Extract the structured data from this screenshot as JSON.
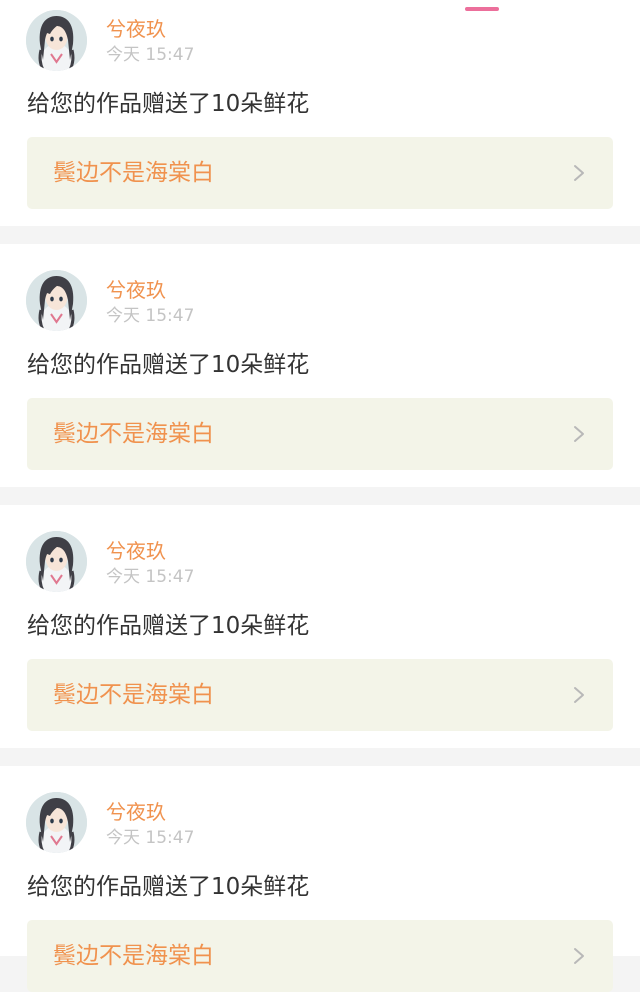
{
  "colors": {
    "accent": "#f0924e",
    "tab_indicator": "#ec6f9b",
    "work_box_bg": "#f3f4e8",
    "page_bg": "#f4f4f4",
    "time_text": "#c4c4c4",
    "message_text": "#333333"
  },
  "notifications": [
    {
      "avatar_icon": "anime-girl-avatar-icon",
      "user_name": "兮夜玖",
      "time": "今天 15:47",
      "message": "给您的作品赠送了10朵鲜花",
      "work_title": "鬓边不是海棠白",
      "chevron_icon": "chevron-right-icon"
    },
    {
      "avatar_icon": "anime-girl-avatar-icon",
      "user_name": "兮夜玖",
      "time": "今天 15:47",
      "message": "给您的作品赠送了10朵鲜花",
      "work_title": "鬓边不是海棠白",
      "chevron_icon": "chevron-right-icon"
    },
    {
      "avatar_icon": "anime-girl-avatar-icon",
      "user_name": "兮夜玖",
      "time": "今天 15:47",
      "message": "给您的作品赠送了10朵鲜花",
      "work_title": "鬓边不是海棠白",
      "chevron_icon": "chevron-right-icon"
    },
    {
      "avatar_icon": "anime-girl-avatar-icon",
      "user_name": "兮夜玖",
      "time": "今天 15:47",
      "message": "给您的作品赠送了10朵鲜花",
      "work_title": "鬓边不是海棠白",
      "chevron_icon": "chevron-right-icon"
    }
  ]
}
